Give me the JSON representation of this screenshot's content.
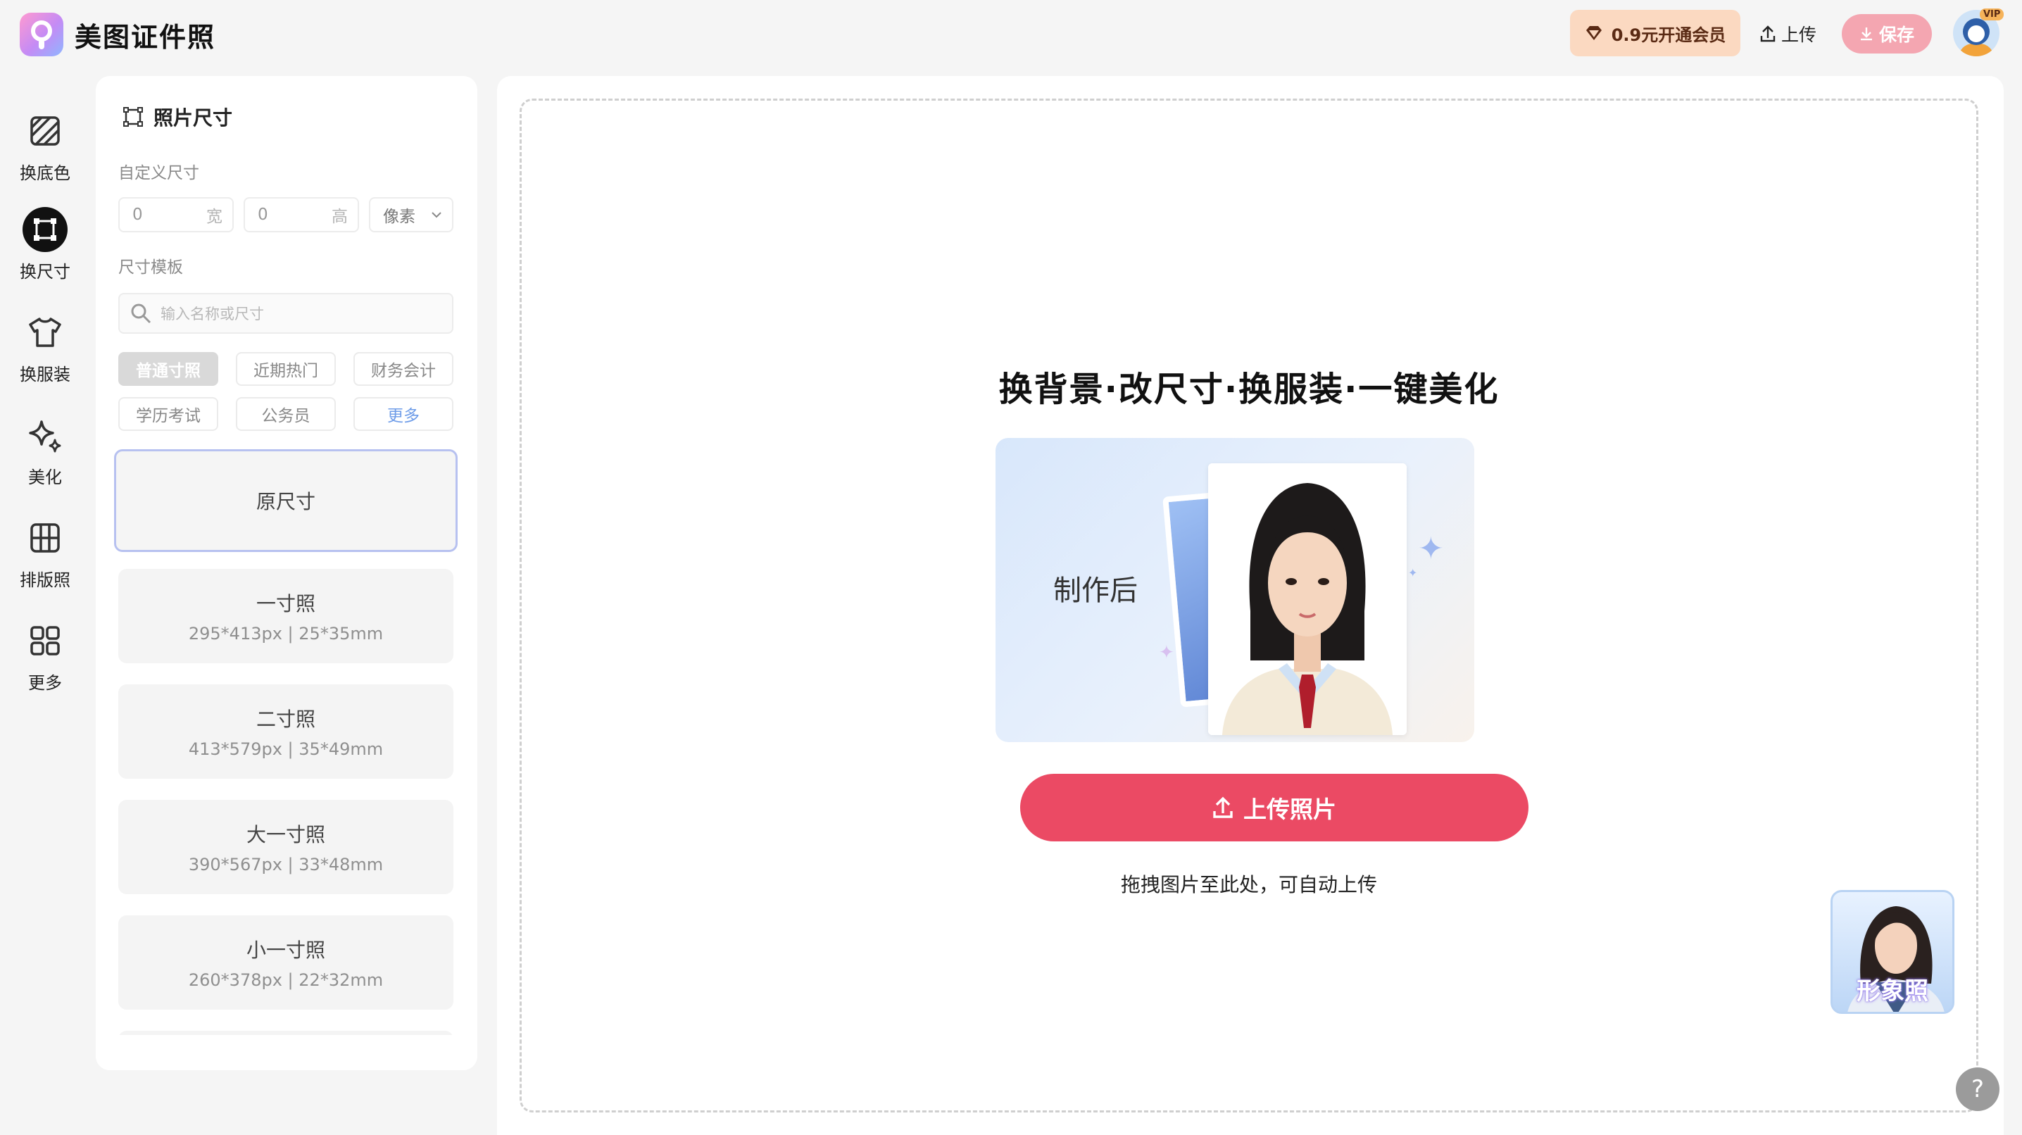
{
  "app": {
    "title": "美图证件照"
  },
  "header": {
    "vip_label": "0.9元开通会员",
    "upload_label": "上传",
    "save_label": "保存",
    "vip_badge": "VIP"
  },
  "rail": {
    "items": [
      {
        "label": "换底色",
        "icon": "background-color-icon"
      },
      {
        "label": "换尺寸",
        "icon": "resize-icon",
        "active": true
      },
      {
        "label": "换服装",
        "icon": "shirt-icon"
      },
      {
        "label": "美化",
        "icon": "sparkle-icon"
      },
      {
        "label": "排版照",
        "icon": "grid-layout-icon"
      },
      {
        "label": "更多",
        "icon": "apps-icon"
      }
    ]
  },
  "panel": {
    "title": "照片尺寸",
    "custom_label": "自定义尺寸",
    "width_value": "0",
    "width_unit": "宽",
    "height_value": "0",
    "height_unit": "高",
    "unit_select": "像素",
    "template_label": "尺寸模板",
    "search_placeholder": "输入名称或尺寸",
    "chips": [
      "普通寸照",
      "近期热门",
      "财务会计",
      "学历考试",
      "公务员",
      "更多"
    ],
    "sizes": [
      {
        "name": "原尺寸",
        "spec": ""
      },
      {
        "name": "一寸照",
        "spec": "295*413px | 25*35mm"
      },
      {
        "name": "二寸照",
        "spec": "413*579px | 35*49mm"
      },
      {
        "name": "大一寸照",
        "spec": "390*567px | 33*48mm"
      },
      {
        "name": "小一寸照",
        "spec": "260*378px | 22*32mm"
      }
    ]
  },
  "canvas": {
    "headline": "换背景·改尺寸·换服装·一键美化",
    "preview_label": "制作后",
    "upload_button": "上传照片",
    "drag_hint": "拖拽图片至此处，可自动上传",
    "promo_label": "形象照",
    "help": "?"
  },
  "colors": {
    "accent": "#eb4a64",
    "vip_bg": "#fbd9c1",
    "save_bg": "#f4a6b1",
    "selected_border": "#b7c1f0"
  }
}
